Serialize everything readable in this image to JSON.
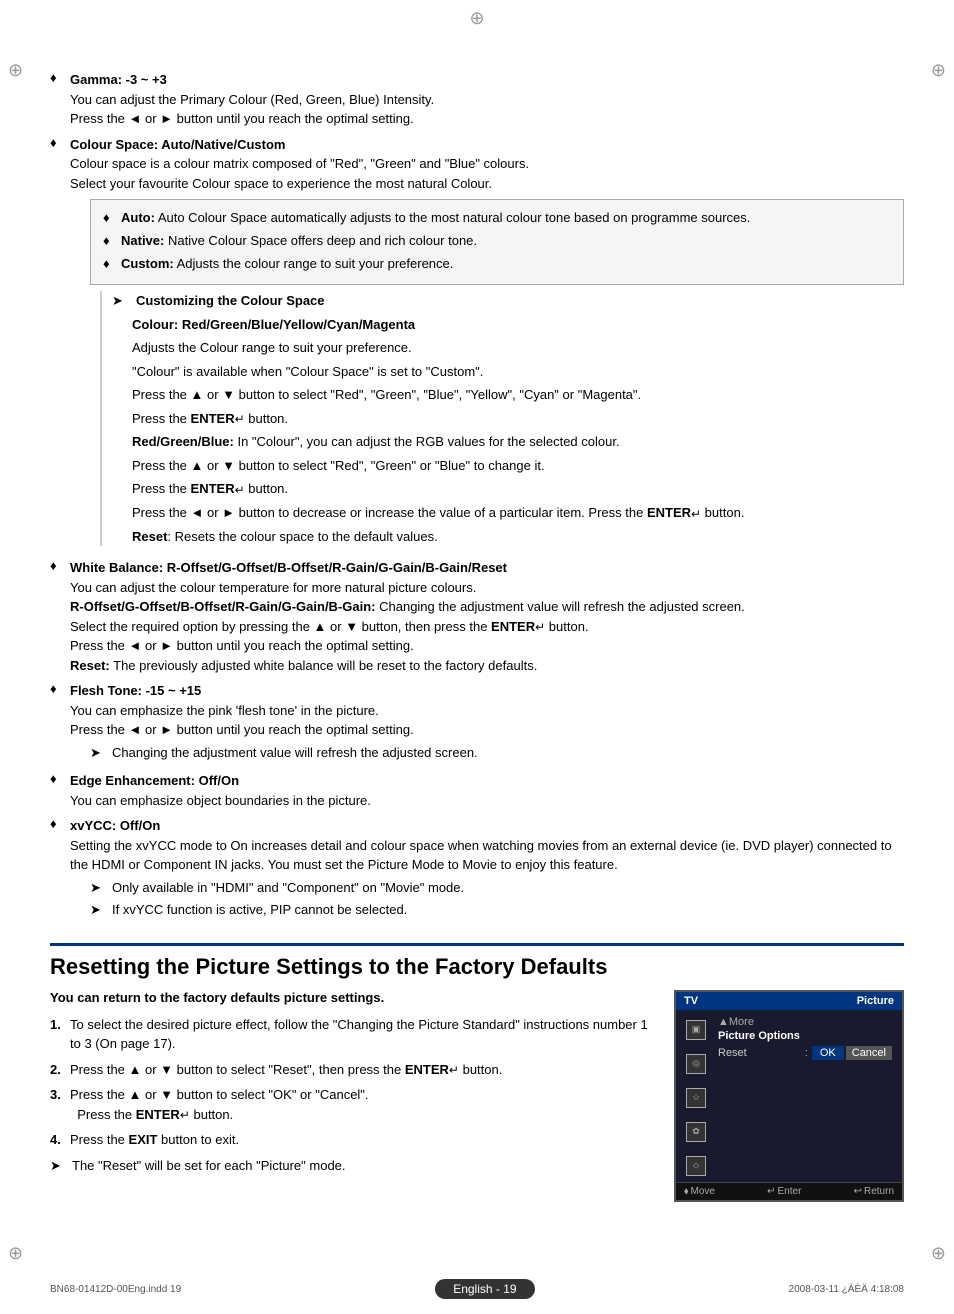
{
  "crosshairs": {
    "top": "⊕",
    "left": "⊕",
    "right": "⊕",
    "bottom_left": "⊕",
    "bottom_right": "⊕"
  },
  "bullets": [
    {
      "id": "gamma",
      "title": "Gamma: -3 ~ +3",
      "lines": [
        "You can adjust the Primary Colour (Red, Green, Blue) Intensity.",
        "Press the ◄ or ► button until you reach the optimal setting."
      ]
    },
    {
      "id": "colour-space",
      "title": "Colour Space: Auto/Native/Custom",
      "lines": [
        "Colour space is a colour matrix composed of \"Red\", \"Green\" and \"Blue\" colours.",
        "Select your favourite Colour space to experience the most natural Colour."
      ],
      "subbox": [
        {
          "label": "Auto:",
          "text": "Auto Colour Space automatically adjusts to the most natural colour tone based on programme sources."
        },
        {
          "label": "Native:",
          "text": "Native Colour Space offers deep and rich colour tone."
        },
        {
          "label": "Custom:",
          "text": "Adjusts the colour range to suit your preference."
        }
      ],
      "customizing": {
        "title": "Customizing the Colour Space",
        "subtitle": "Colour: Red/Green/Blue/Yellow/Cyan/Magenta",
        "paras": [
          "Adjusts the Colour range to suit your preference.",
          "\"Colour\" is available when \"Colour Space\" is set to \"Custom\".",
          "Press the ▲ or ▼ button to select \"Red\", \"Green\", \"Blue\", \"Yellow\", \"Cyan\" or \"Magenta\".",
          "Press the ENTER↵ button.",
          "Red/Green/Blue: In \"Colour\", you can adjust the RGB values for the selected colour.",
          "Press the ▲ or ▼ button to select \"Red\", \"Green\" or \"Blue\" to change it.",
          "Press the ENTER↵ button.",
          "Press the ◄ or ► button to decrease or increase the value of a particular item. Press the ENTER↵ button.",
          "Reset: Resets the colour space to the default values."
        ]
      }
    },
    {
      "id": "white-balance",
      "title": "White Balance: R-Offset/G-Offset/B-Offset/R-Gain/G-Gain/B-Gain/Reset",
      "lines": [
        "You can adjust the colour temperature for more natural picture colours."
      ],
      "bold_line": "R-Offset/G-Offset/B-Offset/R-Gain/G-Gain/B-Gain: Changing the adjustment value will refresh the adjusted screen.",
      "extra_lines": [
        "Select the required option by pressing the ▲ or ▼ button, then press the ENTER↵ button.",
        "Press the ◄ or ► button until you reach the optimal setting."
      ],
      "reset_line": "Reset: The previously adjusted white balance will be reset to the factory defaults."
    },
    {
      "id": "flesh-tone",
      "title": "Flesh Tone: -15 ~ +15",
      "lines": [
        "You can emphasize the pink 'flesh tone' in the picture.",
        "Press the ◄ or ► button until you reach the optimal setting."
      ],
      "note": "Changing the adjustment value will refresh the adjusted screen."
    },
    {
      "id": "edge-enhancement",
      "title": "Edge Enhancement: Off/On",
      "lines": [
        "You can emphasize object boundaries in the picture."
      ]
    },
    {
      "id": "xvycc",
      "title": "xvYCC: Off/On",
      "lines": [
        "Setting the xvYCC mode to On increases detail and colour space when watching movies from an external device (ie. DVD player) connected to the HDMI or Component IN jacks. You must set the Picture Mode to Movie to enjoy this feature."
      ],
      "notes": [
        "Only available in \"HDMI\" and \"Component\" on \"Movie\" mode.",
        "If xvYCC function is active, PIP cannot be selected."
      ]
    }
  ],
  "resetting": {
    "title": "Resetting the Picture Settings to the Factory Defaults",
    "note": "You can return to the factory defaults picture settings.",
    "steps": [
      {
        "num": "1.",
        "text": "To select the desired picture effect, follow the \"Changing the Picture Standard\" instructions number 1 to 3 (On page 17)."
      },
      {
        "num": "2.",
        "text": "Press the ▲ or ▼ button to select \"Reset\", then press the ENTER↵ button."
      },
      {
        "num": "3.",
        "text": "Press the ▲ or ▼ button to select \"OK\" or \"Cancel\".\n Press the ENTER↵ button."
      },
      {
        "num": "4.",
        "text": "Press the EXIT button to exit."
      }
    ],
    "final_note": "The \"Reset\" will be set for each \"Picture\" mode.",
    "tv_screen": {
      "header_left": "TV",
      "header_right": "Picture",
      "more": "▲More",
      "picture_options": "Picture Options",
      "reset_label": "Reset",
      "ok_label": "OK",
      "cancel_label": "Cancel",
      "footer_move": "Move",
      "footer_enter": "Enter",
      "footer_return": "Return"
    }
  },
  "bottom": {
    "left": "BN68-01412D-00Eng.indd   19",
    "lang": "English",
    "page_num": "- 19",
    "right": "2008-03-11   ¿ÀÈÄ 4:18:08"
  }
}
